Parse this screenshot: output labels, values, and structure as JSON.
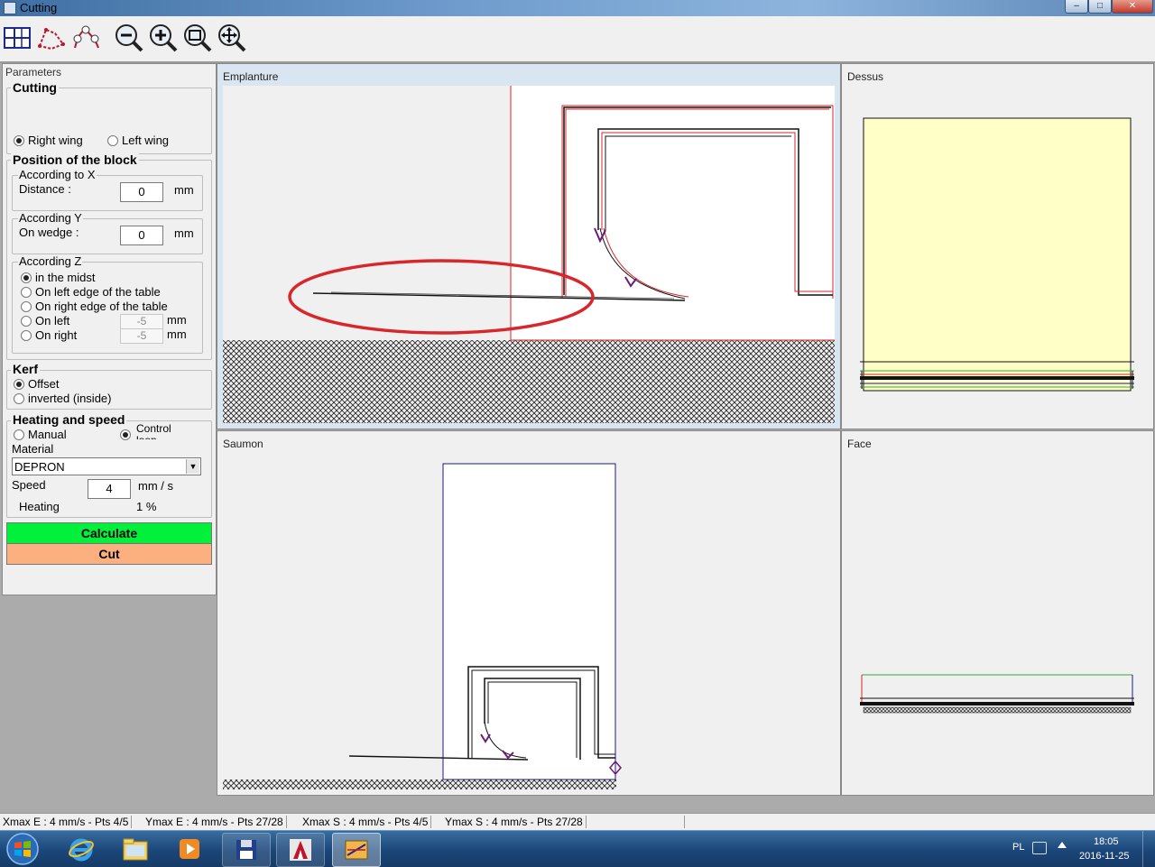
{
  "window": {
    "title": "Cutting"
  },
  "toolbar": {
    "buttons": [
      "views-layout-icon",
      "outline-icon",
      "numbered-points-icon",
      "zoom-out-icon",
      "zoom-in-icon",
      "zoom-fit-icon",
      "pan-icon"
    ]
  },
  "params": {
    "panel_title": "Parameters",
    "cutting": {
      "title": "Cutting",
      "right_wing": "Right wing",
      "left_wing": "Left wing",
      "selected": "Right wing"
    },
    "position": {
      "title": "Position of the block",
      "x": {
        "title": "According to X",
        "label": "Distance :",
        "value": "0",
        "unit": "mm"
      },
      "y": {
        "title": "According Y",
        "label": "On wedge :",
        "value": "0",
        "unit": "mm"
      },
      "z": {
        "title": "According Z",
        "opt_midst": "in the midst",
        "opt_left_edge": "On left edge of the table",
        "opt_right_edge": "On right edge of the table",
        "opt_left": "On left",
        "opt_right": "On right",
        "left_value": "-5",
        "right_value": "-5",
        "unit": "mm",
        "selected": "in the midst"
      }
    },
    "kerf": {
      "title": "Kerf",
      "offset": "Offset",
      "inverted": "inverted (inside)",
      "selected": "Offset"
    },
    "heating": {
      "title": "Heating and speed",
      "manual": "Manual",
      "control_loop": "Control loop",
      "selected": "Control loop",
      "material_label": "Material",
      "material_value": "DEPRON",
      "speed_label": "Speed",
      "speed_value": "4",
      "speed_unit": "mm / s",
      "heating_label": "Heating",
      "heating_value": "1 %"
    },
    "calculate": "Calculate",
    "cut": "Cut"
  },
  "views": {
    "emplanture": "Emplanture",
    "dessus": "Dessus",
    "saumon": "Saumon",
    "face": "Face"
  },
  "colors": {
    "calculate": "#00f03c",
    "cut": "#fcb07f",
    "annotation": "#d9262b",
    "path_purple": "#6a1b7a",
    "block_outline_blue": "#1a1a80",
    "dessus_fill": "#ffffc8"
  },
  "status": {
    "xmax_e": "Xmax E : 4 mm/s - Pts 4/5",
    "ymax_e": "Ymax E : 4 mm/s - Pts 27/28",
    "xmax_s": "Xmax S : 4 mm/s - Pts 4/5",
    "ymax_s": "Ymax S : 4 mm/s - Pts 27/28"
  },
  "taskbar": {
    "lang": "PL",
    "time": "18:05",
    "date": "2016-11-25"
  }
}
